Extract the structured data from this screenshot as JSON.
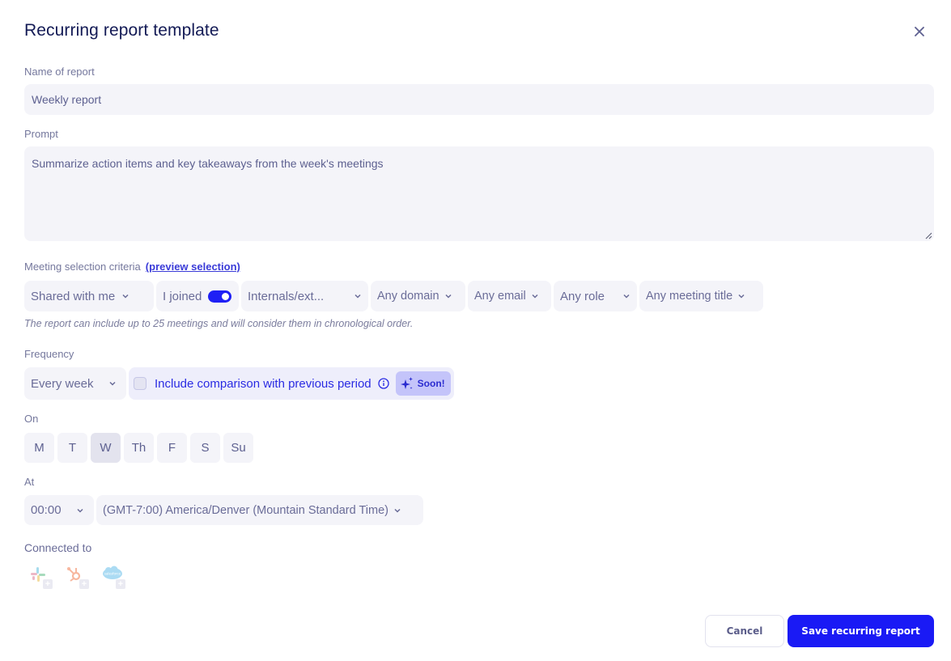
{
  "dialog": {
    "title": "Recurring report template",
    "close_icon": "close-icon"
  },
  "name_field": {
    "label": "Name of report",
    "value": "Weekly report"
  },
  "prompt_field": {
    "label": "Prompt",
    "value": "Summarize action items and key takeaways from the week's meetings"
  },
  "criteria": {
    "label": "Meeting selection criteria",
    "preview_link": "(preview selection)",
    "filters": {
      "shared": "Shared with me",
      "joined": "I joined",
      "joined_on": true,
      "internals": "Internals/ext...",
      "domain": "Any domain",
      "email": "Any email",
      "role": "Any role",
      "title": "Any meeting title"
    },
    "hint": "The report can include up to 25 meetings and will consider them in chronological order."
  },
  "frequency": {
    "label": "Frequency",
    "value": "Every week",
    "comparison_label": "Include comparison with previous period",
    "comparison_checked": false,
    "soon_badge": "Soon!"
  },
  "on": {
    "label": "On",
    "days": [
      {
        "label": "M",
        "selected": false
      },
      {
        "label": "T",
        "selected": false
      },
      {
        "label": "W",
        "selected": true
      },
      {
        "label": "Th",
        "selected": false
      },
      {
        "label": "F",
        "selected": false
      },
      {
        "label": "S",
        "selected": false
      },
      {
        "label": "Su",
        "selected": false
      }
    ]
  },
  "at": {
    "label": "At",
    "time": "00:00",
    "timezone": "(GMT-7:00) America/Denver (Mountain Standard Time)"
  },
  "connected": {
    "label": "Connected to",
    "integrations": [
      "slack-icon",
      "hubspot-icon",
      "salesforce-icon"
    ]
  },
  "footer": {
    "cancel": "Cancel",
    "save": "Save recurring report"
  },
  "colors": {
    "accent": "#1a1af5",
    "title": "#131a55",
    "field_bg": "#f4f4f9"
  }
}
